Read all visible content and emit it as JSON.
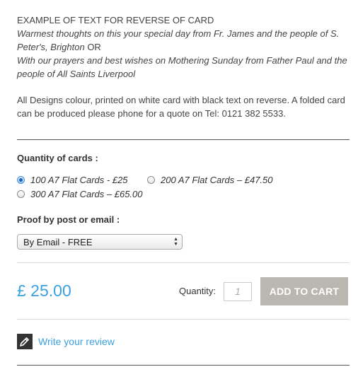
{
  "description": {
    "heading": "EXAMPLE OF TEXT FOR REVERSE OF CARD",
    "example1": "Warmest thoughts on this your special day from Fr. James and the people of S. Peter's, Brighton",
    "or_text": " OR",
    "example2": "With our prayers and best wishes on Mothering Sunday from Father Paul and the people of All Saints Liverpool",
    "info": "All Designs colour, printed on white card with black text on reverse. A folded card can be produced please phone for a quote on Tel: 0121 382 5533."
  },
  "quantity": {
    "label": "Quantity of cards :",
    "options": [
      {
        "label": "100 A7 Flat Cards - £25",
        "selected": true
      },
      {
        "label": "200 A7 Flat Cards – £47.50",
        "selected": false
      },
      {
        "label": "300 A7 Flat Cards – £65.00",
        "selected": false
      }
    ]
  },
  "proof": {
    "label": "Proof by post or email :",
    "selected": "By Email - FREE"
  },
  "purchase": {
    "price": "£ 25.00",
    "quantity_label": "Quantity:",
    "quantity_value": "1",
    "add_to_cart": "ADD TO CART"
  },
  "review": {
    "link": "Write your review",
    "icon": "pencil-edit-icon"
  },
  "colors": {
    "accent": "#3aa0e0",
    "cart_button": "#b9b7b0"
  }
}
